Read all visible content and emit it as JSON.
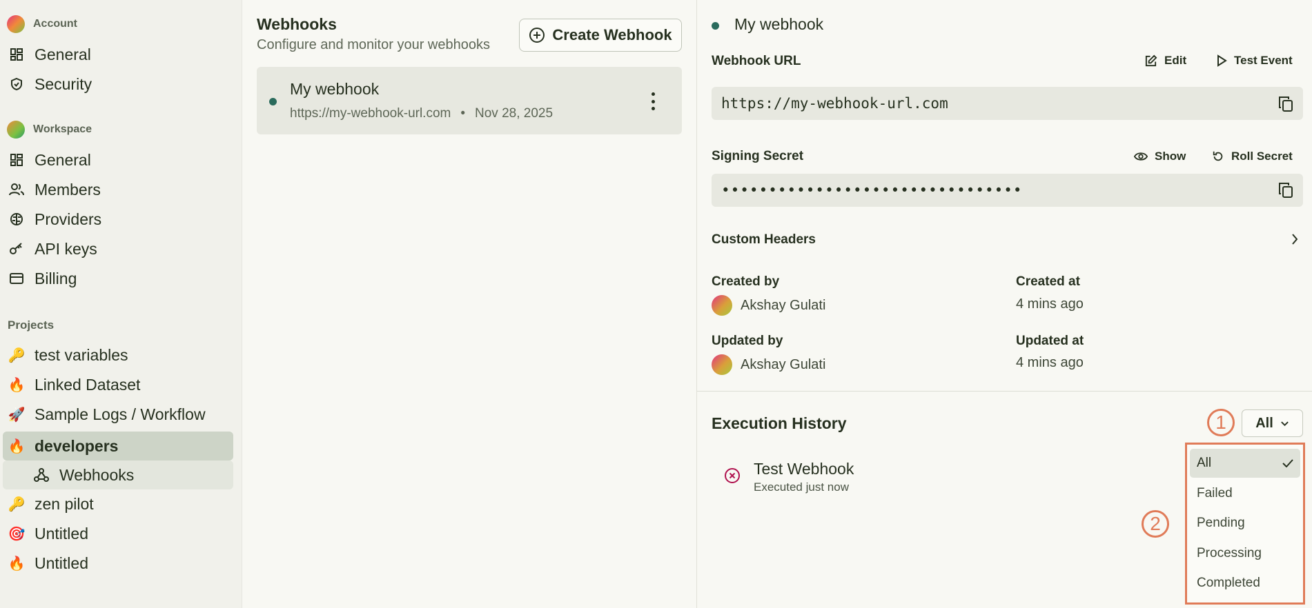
{
  "sidebar": {
    "account_header": "Account",
    "account_items": [
      {
        "label": "General",
        "icon": "grid-icon"
      },
      {
        "label": "Security",
        "icon": "shield-icon"
      }
    ],
    "workspace_header": "Workspace",
    "workspace_items": [
      {
        "label": "General",
        "icon": "grid-icon"
      },
      {
        "label": "Members",
        "icon": "users-icon"
      },
      {
        "label": "Providers",
        "icon": "brain-icon"
      },
      {
        "label": "API keys",
        "icon": "key-icon"
      },
      {
        "label": "Billing",
        "icon": "card-icon"
      }
    ],
    "projects_header": "Projects",
    "projects": [
      {
        "label": "test variables",
        "emoji": "🔑"
      },
      {
        "label": "Linked Dataset",
        "emoji": "🔥"
      },
      {
        "label": "Sample Logs / Workflow",
        "emoji": "🚀"
      },
      {
        "label": "developers",
        "emoji": "🔥"
      },
      {
        "label": "Webhooks",
        "icon": "webhook-icon"
      },
      {
        "label": "zen pilot",
        "emoji": "🔑"
      },
      {
        "label": "Untitled",
        "emoji": "🎯"
      },
      {
        "label": "Untitled",
        "emoji": "🔥"
      }
    ]
  },
  "webhooks": {
    "title": "Webhooks",
    "subtitle": "Configure and monitor your webhooks",
    "create_label": "Create Webhook",
    "items": [
      {
        "name": "My webhook",
        "url": "https://my-webhook-url.com",
        "sep": "•",
        "date": "Nov 28, 2025"
      }
    ]
  },
  "detail": {
    "name": "My webhook",
    "url_label": "Webhook URL",
    "edit_label": "Edit",
    "test_label": "Test Event",
    "url_value": "https://my-webhook-url.com",
    "secret_label": "Signing Secret",
    "show_label": "Show",
    "roll_label": "Roll Secret",
    "secret_value": "••••••••••••••••••••••••••••••••",
    "custom_headers_label": "Custom Headers",
    "created_by_label": "Created by",
    "created_by": "Akshay Gulati",
    "created_at_label": "Created at",
    "created_at": "4 mins ago",
    "updated_by_label": "Updated by",
    "updated_by": "Akshay Gulati",
    "updated_at_label": "Updated at",
    "updated_at": "4 mins ago"
  },
  "history": {
    "title": "Execution History",
    "filter_value": "All",
    "items": [
      {
        "title": "Test Webhook",
        "sub": "Executed just now",
        "status": "failed"
      }
    ],
    "options": [
      "All",
      "Failed",
      "Pending",
      "Processing",
      "Completed"
    ],
    "selected": "All"
  },
  "annotations": {
    "marker1": "1",
    "marker2": "2"
  },
  "colors": {
    "accent": "#e07b58",
    "status_dot": "#2a6b5c",
    "failed": "#b0124e"
  }
}
